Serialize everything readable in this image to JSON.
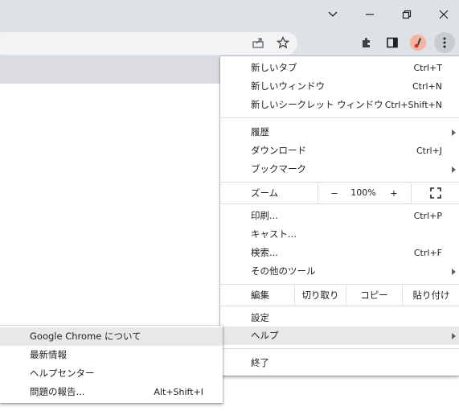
{
  "window": {
    "icons": [
      "chevron-down-icon",
      "minimize-icon",
      "restore-icon",
      "close-icon"
    ]
  },
  "toolbar": {
    "icons": [
      "share-icon",
      "star-icon",
      "extensions-icon",
      "side-panel-icon",
      "profile-avatar-icon",
      "kebab-menu-icon"
    ]
  },
  "menu": {
    "new_tab": {
      "label": "新しいタブ",
      "shortcut": "Ctrl+T"
    },
    "new_window": {
      "label": "新しいウィンドウ",
      "shortcut": "Ctrl+N"
    },
    "new_incognito": {
      "label": "新しいシークレット ウィンドウ",
      "shortcut": "Ctrl+Shift+N"
    },
    "history": {
      "label": "履歴"
    },
    "downloads": {
      "label": "ダウンロード",
      "shortcut": "Ctrl+J"
    },
    "bookmarks": {
      "label": "ブックマーク"
    },
    "zoom": {
      "label": "ズーム",
      "minus": "−",
      "value": "100%",
      "plus": "+"
    },
    "print": {
      "label": "印刷...",
      "shortcut": "Ctrl+P"
    },
    "cast": {
      "label": "キャスト..."
    },
    "find": {
      "label": "検索...",
      "shortcut": "Ctrl+F"
    },
    "more_tools": {
      "label": "その他のツール"
    },
    "edit": {
      "label": "編集",
      "cut": "切り取り",
      "copy": "コピー",
      "paste": "貼り付け"
    },
    "settings": {
      "label": "設定"
    },
    "help": {
      "label": "ヘルプ"
    },
    "exit": {
      "label": "終了"
    }
  },
  "help_submenu": {
    "about": {
      "label": "Google Chrome について"
    },
    "whats_new": {
      "label": "最新情報"
    },
    "help_center": {
      "label": "ヘルプセンター"
    },
    "report_issue": {
      "label": "問題の報告...",
      "shortcut": "Alt+Shift+I"
    }
  },
  "colors": {
    "frame": "#dee1e6",
    "highlight": "#e8e8e8",
    "separator": "#dadce0"
  }
}
